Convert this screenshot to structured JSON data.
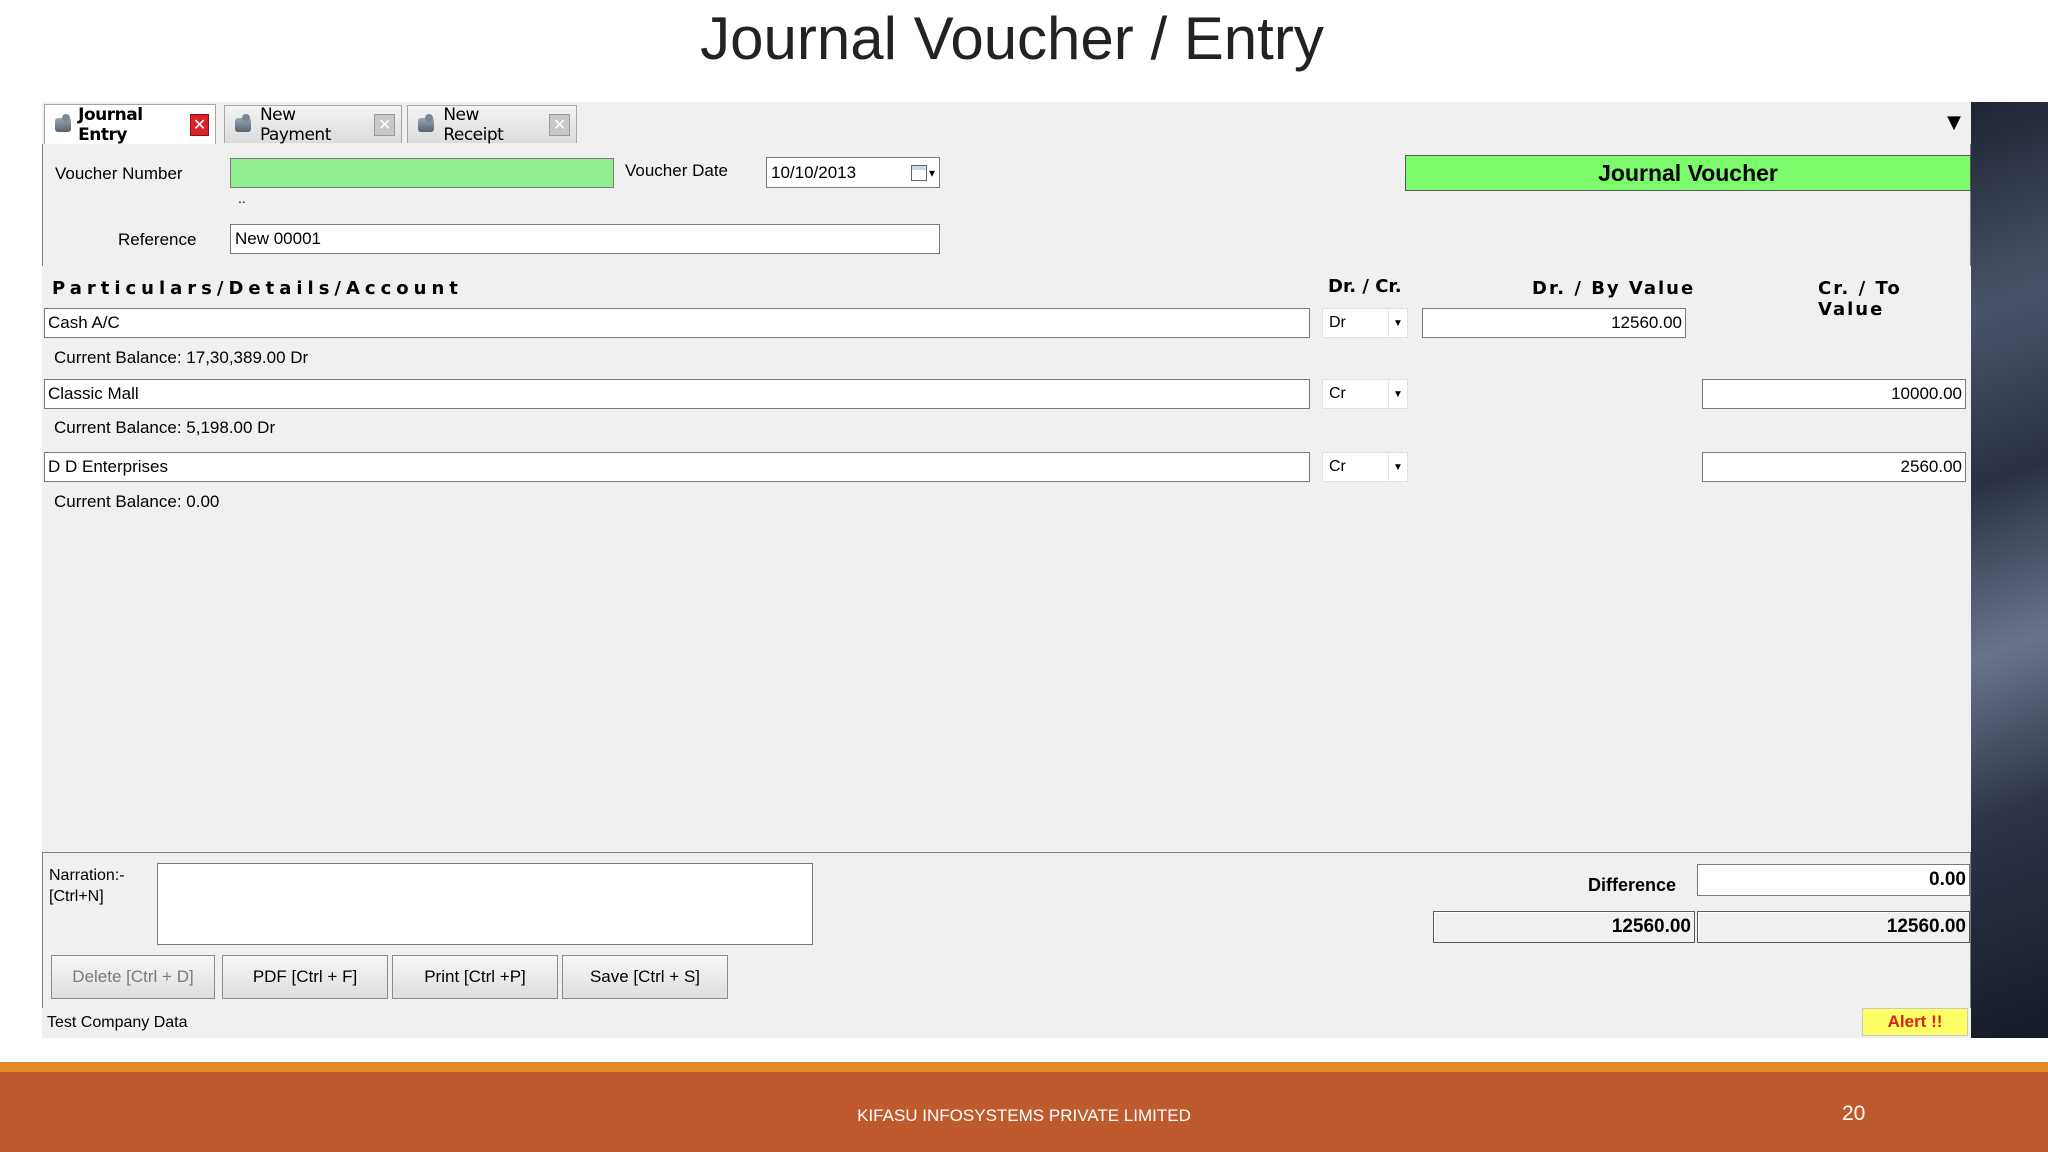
{
  "slide": {
    "title": "Journal Voucher / Entry",
    "footer_text": "KIFASU INFOSYSTEMS PRIVATE LIMITED",
    "page_number": "20"
  },
  "tabs": [
    {
      "label": "Journal Entry",
      "active": true
    },
    {
      "label": "New Payment",
      "active": false
    },
    {
      "label": "New Receipt",
      "active": false
    }
  ],
  "header": {
    "voucher_number_label": "Voucher Number",
    "voucher_number_value": "",
    "voucher_date_label": "Voucher Date",
    "voucher_date_value": "10/10/2013",
    "dots": "..",
    "reference_label": "Reference",
    "reference_value": "New 00001",
    "voucher_type": "Journal Voucher"
  },
  "columns": {
    "particulars": "Particulars/Details/Account",
    "drcr": "Dr. / Cr.",
    "dr_value": "Dr. / By Value",
    "cr_value": "Cr. / To Value"
  },
  "lines": [
    {
      "account": "Cash A/C",
      "drcr": "Dr",
      "dr_value": "12560.00",
      "cr_value": "",
      "balance": "Current Balance: 17,30,389.00 Dr"
    },
    {
      "account": "Classic Mall",
      "drcr": "Cr",
      "dr_value": "",
      "cr_value": "10000.00",
      "balance": "Current Balance: 5,198.00 Dr"
    },
    {
      "account": "D D Enterprises",
      "drcr": "Cr",
      "dr_value": "",
      "cr_value": "2560.00",
      "balance": "Current Balance: 0.00"
    }
  ],
  "footer": {
    "narration_label_1": "Narration:-",
    "narration_label_2": "[Ctrl+N]",
    "narration_value": "",
    "difference_label": "Difference",
    "difference_value": "0.00",
    "total_dr": "12560.00",
    "total_cr": "12560.00",
    "buttons": {
      "delete": "Delete [Ctrl + D]",
      "pdf": "PDF [Ctrl + F]",
      "print": "Print [Ctrl +P]",
      "save": "Save [Ctrl + S]"
    }
  },
  "status": {
    "company": "Test Company Data",
    "alert": "Alert !!"
  },
  "colors": {
    "green_field": "#90ee90",
    "banner_green": "#7cfc6c",
    "close_red": "#d8232a",
    "footer_orange": "#bf5a2e",
    "alert_yellow": "#ffff66"
  }
}
